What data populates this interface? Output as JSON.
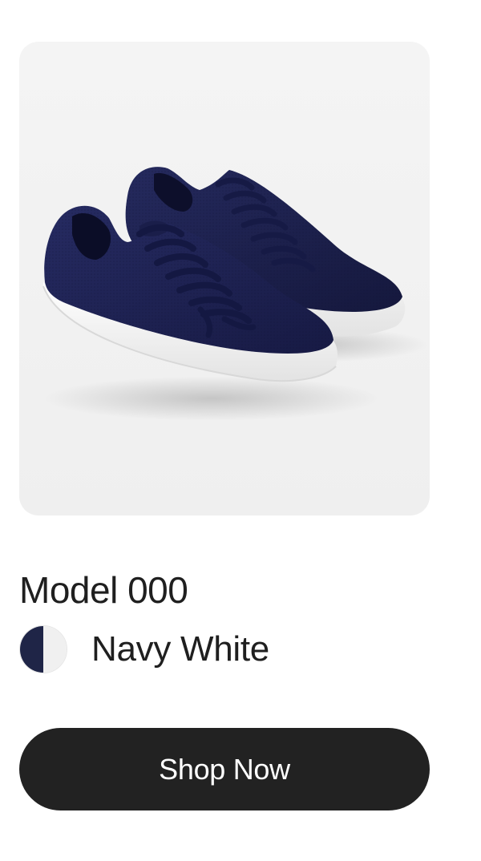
{
  "product": {
    "title": "Model 000",
    "image_icon": "sneaker-pair-image",
    "color": {
      "name": "Navy White",
      "primary_hex": "#1f2547",
      "secondary_hex": "#f0f0f0"
    },
    "cta_label": "Shop Now"
  },
  "colors": {
    "text": "#1f1f1f",
    "button_bg": "#222222",
    "button_text": "#ffffff",
    "tile_bg": "#f1f1f1",
    "shoe_upper": "#1e2150",
    "shoe_sole": "#ffffff"
  }
}
